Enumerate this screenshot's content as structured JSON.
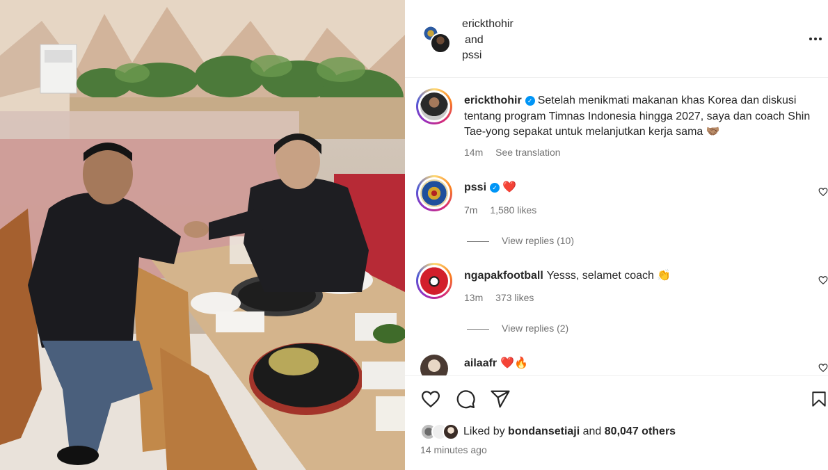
{
  "header": {
    "user1": "erickthohir",
    "and": "and",
    "user2": "pssi"
  },
  "caption": {
    "username": "erickthohir",
    "text": "Setelah menikmati makanan khas Korea dan diskusi tentang program Timnas Indonesia hingga 2027, saya dan coach Shin Tae-yong sepakat untuk melanjutkan kerja sama 🤝🏽",
    "time": "14m",
    "translate": "See translation"
  },
  "comments": [
    {
      "username": "pssi",
      "text": "❤️",
      "time": "7m",
      "likes": "1,580 likes",
      "replies": "View replies (10)"
    },
    {
      "username": "ngapakfootball",
      "text": "Yesss, selamet coach 👏",
      "time": "13m",
      "likes": "373 likes",
      "replies": "View replies (2)"
    },
    {
      "username": "ailaafr",
      "text": "❤️🔥"
    }
  ],
  "likes": {
    "prefix": "Liked by",
    "user": "bondansetiaji",
    "and": "and",
    "others": "80,047 others"
  },
  "timestamp": "14 minutes ago",
  "colors": {
    "verified": "#0095f6",
    "heart": "#ed4956",
    "muted": "#737373"
  }
}
